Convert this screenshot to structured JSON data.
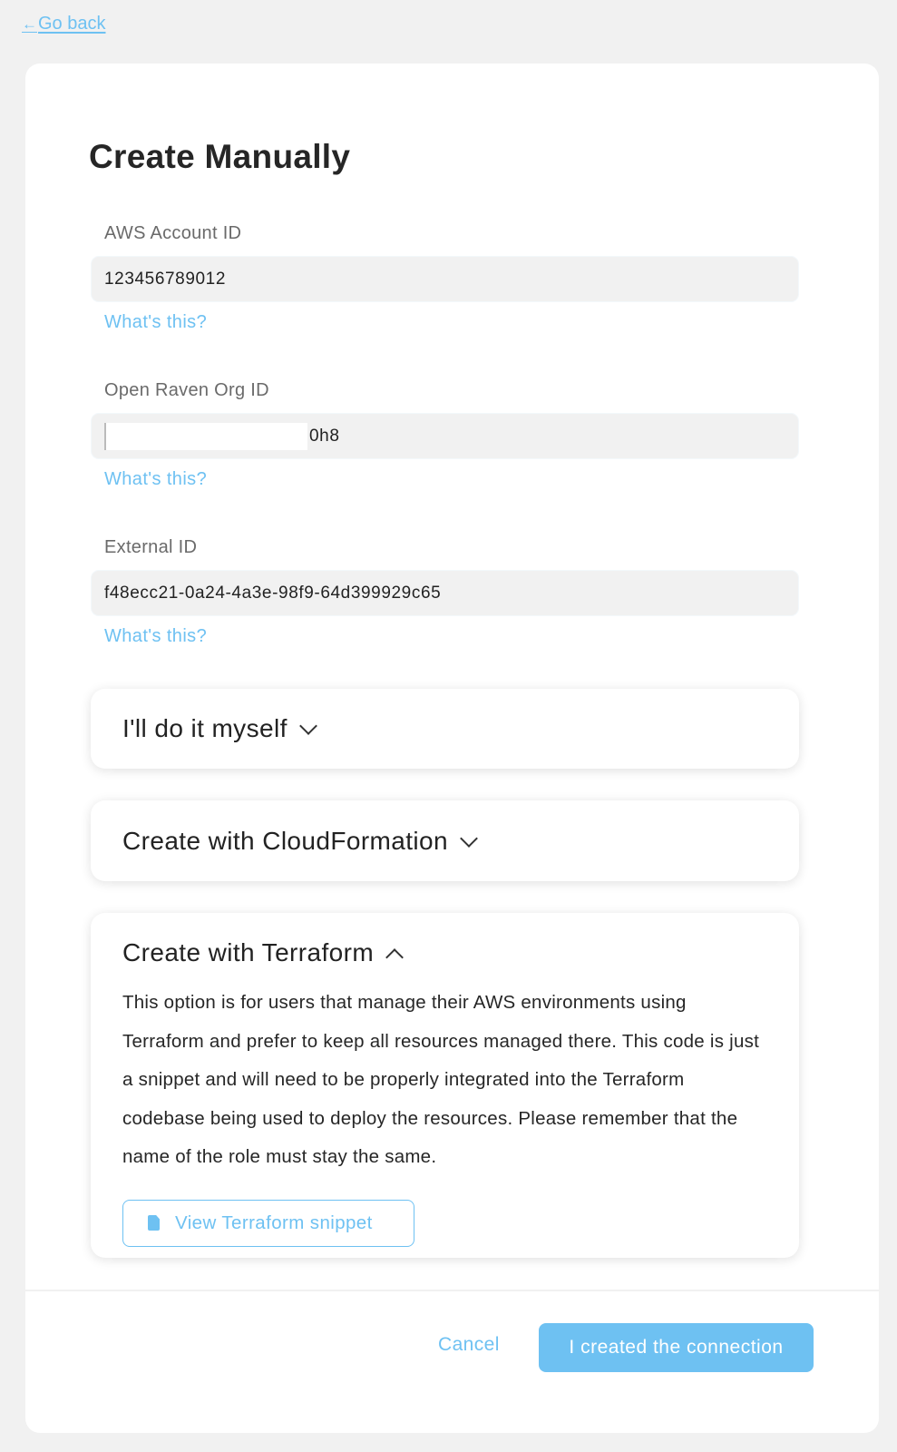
{
  "nav": {
    "back_label": " Go back",
    "back_icon": "arrow-left-icon"
  },
  "page": {
    "title": "Create Manually"
  },
  "fields": [
    {
      "label": "AWS Account ID",
      "value": "123456789012",
      "help_link": "What's this?"
    },
    {
      "label": "Open Raven Org ID",
      "value_visible_suffix": "0h8",
      "redacted": true,
      "help_link": "What's this?"
    },
    {
      "label": "External ID",
      "value": "f48ecc21-0a24-4a3e-98f9-64d399929c65",
      "help_link": "What's this?"
    }
  ],
  "panels": [
    {
      "title": "I'll do it myself",
      "expanded": false,
      "icon": "chevron-down-icon"
    },
    {
      "title": "Create with CloudFormation",
      "expanded": false,
      "icon": "chevron-down-icon"
    },
    {
      "title": "Create with Terraform",
      "expanded": true,
      "icon": "chevron-up-icon",
      "description": "This option is for users that manage their AWS environments using Terraform and prefer to keep all resources managed there. This code is just a snippet and will need to be properly integrated into the Terraform codebase being used to deploy the resources. Please remember that the name of the role must stay the same.",
      "button_label": "View Terraform snippet",
      "button_icon": "document-icon"
    }
  ],
  "footer": {
    "cancel_label": "Cancel",
    "confirm_label": "I created the connection"
  },
  "colors": {
    "accent": "#6ec1f2",
    "background": "#f1f1f1",
    "card": "#ffffff",
    "text": "#262626"
  }
}
